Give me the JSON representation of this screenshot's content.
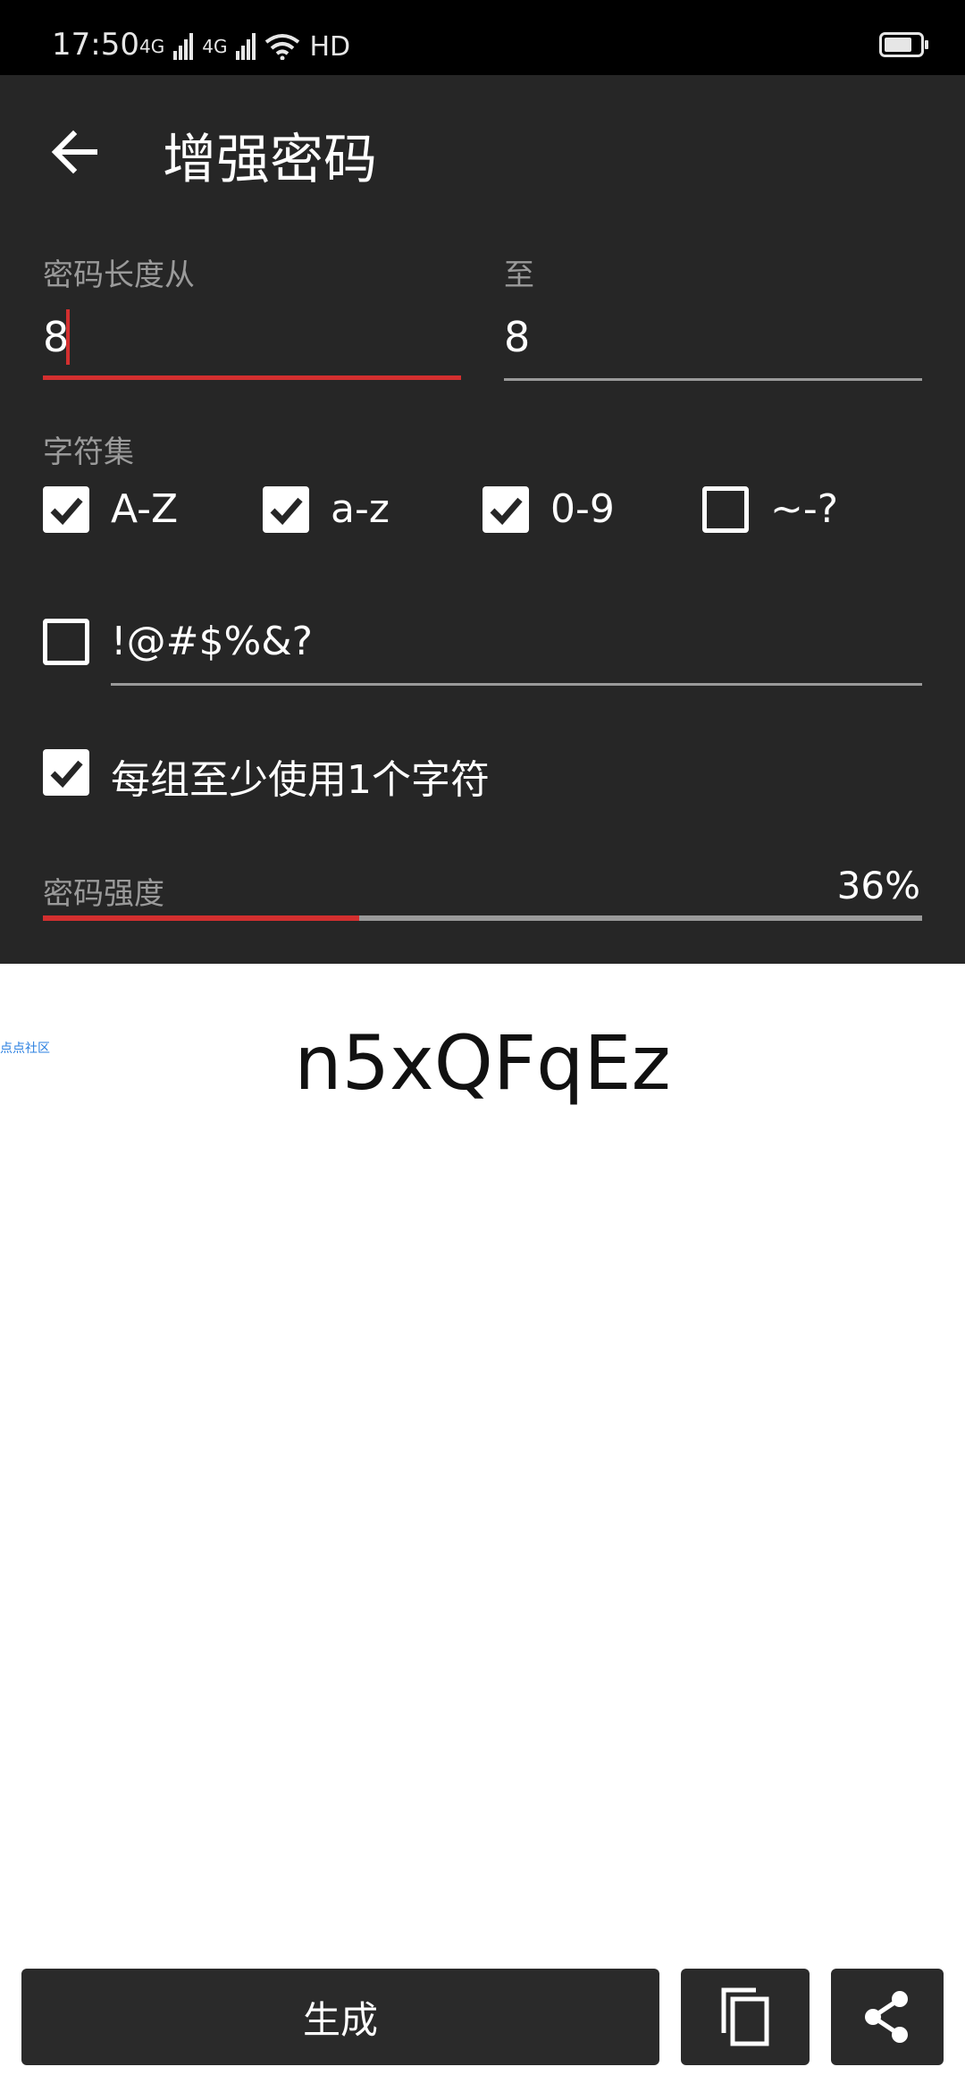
{
  "status_bar": {
    "time": "17:50",
    "network1": "4G",
    "network2": "4G",
    "hd": "HD"
  },
  "appbar": {
    "title": "增强密码",
    "back_icon": "arrow-left-icon"
  },
  "length": {
    "from_label": "密码长度从",
    "from_value": "8",
    "to_label": "至",
    "to_value": "8"
  },
  "charset": {
    "label": "字符集",
    "options": [
      {
        "label": "A-Z",
        "checked": true
      },
      {
        "label": "a-z",
        "checked": true
      },
      {
        "label": "0-9",
        "checked": true
      },
      {
        "label": "~-?",
        "checked": false
      }
    ],
    "custom": {
      "value": "!@#$%&?",
      "checked": false
    }
  },
  "min_each": {
    "label": "每组至少使用1个字符",
    "checked": true
  },
  "strength": {
    "label": "密码强度",
    "value_text": "36%",
    "fraction": 0.36
  },
  "watermark": "点点社区",
  "password": "n5xQFqEz",
  "actions": {
    "generate_label": "生成",
    "copy_icon": "copy-icon",
    "share_icon": "share-icon"
  },
  "colors": {
    "accent": "#d32f2f",
    "panel_bg": "#262626",
    "button_bg": "#2a2a2a"
  }
}
